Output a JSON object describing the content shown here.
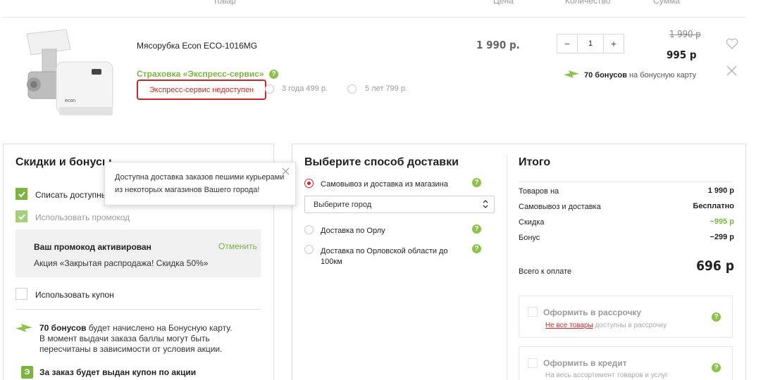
{
  "table_header": {
    "product": "Товар",
    "price": "Цена",
    "quantity": "Количество",
    "sum": "Сумма"
  },
  "product": {
    "name": "Мясорубка Econ ECO-1016MG",
    "brand_text": "econ",
    "price": "1 990 р.",
    "quantity": "1",
    "qty_minus": "−",
    "qty_plus": "+",
    "old_sum": "1 990 р",
    "sum": "995 р",
    "bonus_amount": "70 бонусов",
    "bonus_text": "на бонусную карту",
    "insurance_title": "Страховка «Экспресс-сервис»",
    "insurance_unavailable": "Экспресс-сервис недоступен",
    "insurance_options": [
      "3 года 499 р.",
      "5 лет 799 р."
    ]
  },
  "discounts": {
    "title": "Скидки и бонусы",
    "write_off_label": "Списать доступные",
    "promo_label": "Использовать промокод",
    "promo_box_title": "Ваш промокод активирован",
    "promo_cancel": "Отменить",
    "promo_box_text": "Акция «Закрытая распродажа! Скидка 50%»",
    "coupon_label": "Использовать купон",
    "bonus_bold": "70 бонусов",
    "bonus_text_1": "будет начислено на Бонусную карту.",
    "bonus_text_2": "В момент выдачи заказа баллы могут быть",
    "bonus_text_3": "пересчитаны в зависимости от условия акции.",
    "coupon_bold": "За заказ будет выдан купон по акции"
  },
  "tooltip": {
    "line1": "Доступна доставка заказов пешими курьерами",
    "line2": "из некоторых магазинов Вашего города!"
  },
  "delivery": {
    "title": "Выберите способ доставки",
    "option_pickup": "Самовывоз и доставка из магазина",
    "city_placeholder": "Выберите город",
    "option_city": "Доставка по Орлу",
    "option_region_1": "Доставка по Орловской области до",
    "option_region_2": "100км"
  },
  "totals": {
    "title": "Итого",
    "rows": [
      {
        "label": "Товаров на",
        "value": "1 990 р"
      },
      {
        "label": "Самовывоз и доставка",
        "value": "Бесплатно"
      },
      {
        "label": "Скидка",
        "value": "−995 р"
      },
      {
        "label": "Бонус",
        "value": "−299 р"
      }
    ],
    "grand_label": "Всего к оплате",
    "grand_value": "696 р",
    "installment_title": "Оформить в рассрочку",
    "installment_link": "Не все товары",
    "installment_note": "доступны в рассрочку",
    "credit_title": "Оформить в кредит",
    "credit_note": "На весь ассортимент товаров и услуг"
  },
  "colors": {
    "accent_green": "#7cb342",
    "error_red": "#c62828"
  }
}
